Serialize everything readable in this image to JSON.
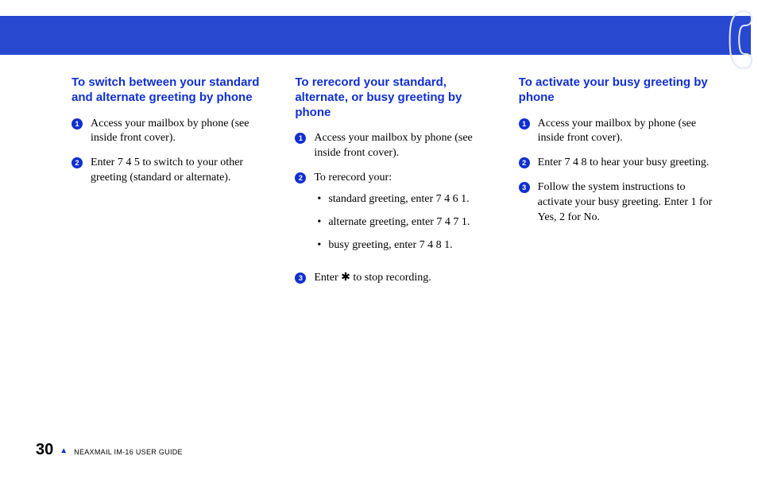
{
  "columns": [
    {
      "heading": "To switch between your stan­dard and alternate greeting by phone",
      "items": [
        {
          "type": "num",
          "n": "1",
          "text": "Access your mailbox by phone (see inside front cover)."
        },
        {
          "type": "num",
          "n": "2",
          "text": "Enter 7 4 5 to switch to your other greeting (standard or alternate)."
        }
      ]
    },
    {
      "heading": "To rerecord your standard, alternate, or busy greeting by phone",
      "items": [
        {
          "type": "num",
          "n": "1",
          "text": "Access your mailbox by phone (see inside front cover)."
        },
        {
          "type": "num",
          "n": "2",
          "text": "To rerecord your:",
          "bullets": [
            "standard greeting, enter 7 4 6 1.",
            "alternate greeting, enter 7 4 7 1.",
            "busy greeting, enter 7 4 8 1."
          ]
        },
        {
          "type": "num",
          "n": "3",
          "text": "Enter ✱ to stop recording."
        }
      ]
    },
    {
      "heading": "To activate your busy greeting by phone",
      "items": [
        {
          "type": "num",
          "n": "1",
          "text": "Access your mailbox by phone (see inside front cover)."
        },
        {
          "type": "num",
          "n": "2",
          "text": "Enter 7 4 8 to hear your busy greet­ing."
        },
        {
          "type": "num",
          "n": "3",
          "text": "Follow the system instructions to activate your busy greeting. Enter 1 for Yes, 2 for No."
        }
      ]
    }
  ],
  "footer": {
    "page": "30",
    "marker": "▲",
    "guide": "NEAXMAIL IM-16 USER GUIDE"
  }
}
